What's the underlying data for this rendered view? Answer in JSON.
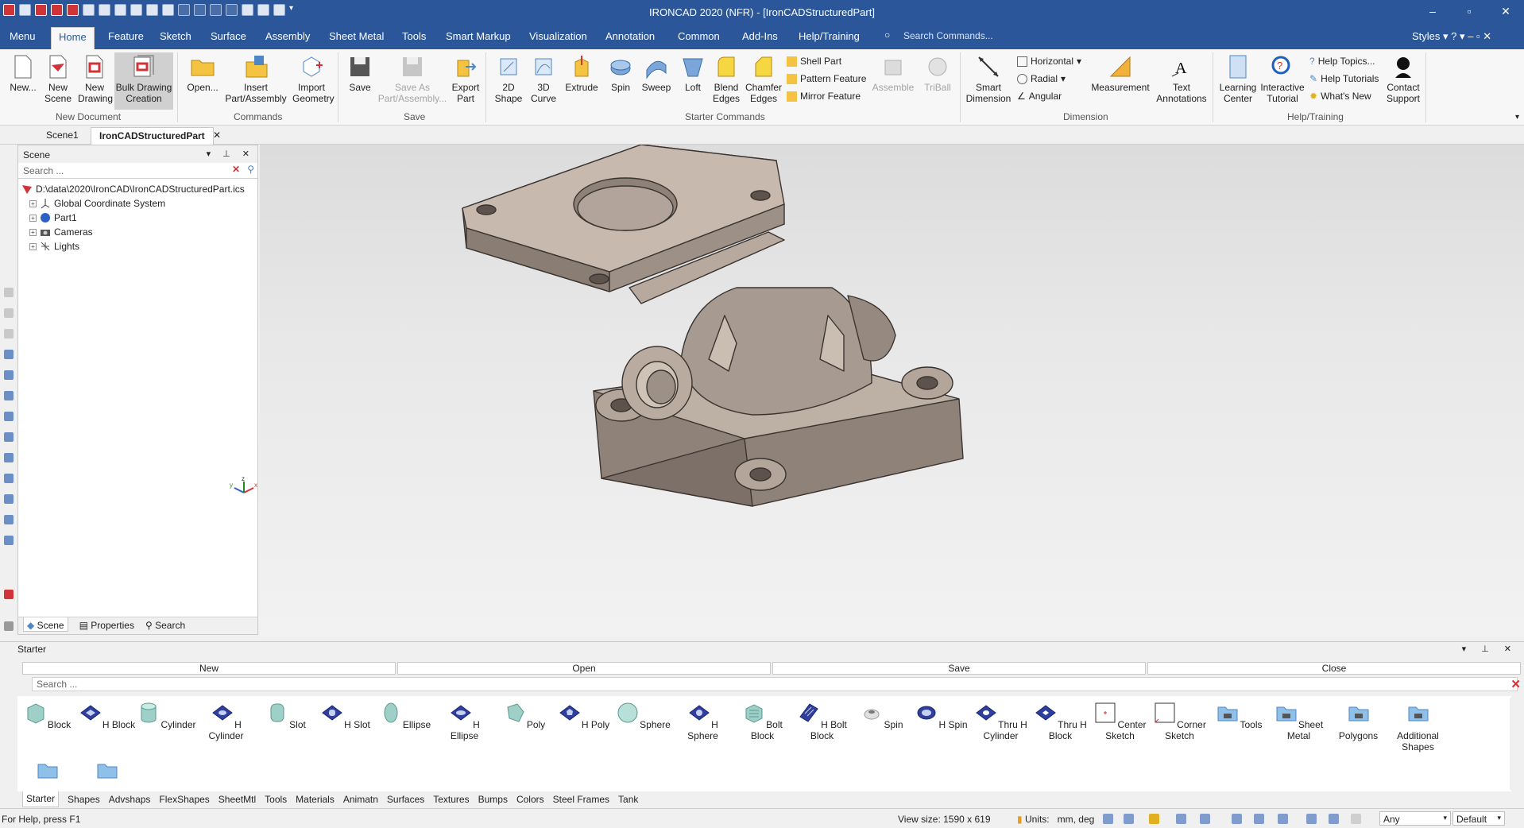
{
  "window": {
    "title": "IRONCAD 2020 (NFR) - [IronCADStructuredPart]"
  },
  "menu_tabs": [
    "Menu",
    "Home",
    "Feature",
    "Sketch",
    "Surface",
    "Assembly",
    "Sheet Metal",
    "Tools",
    "Smart Markup",
    "Visualization",
    "Annotation",
    "Common",
    "Add-Ins",
    "Help/Training"
  ],
  "search_commands": "Search Commands...",
  "styles_label": "Styles",
  "ribbon": {
    "new_document": {
      "label": "New Document",
      "new": "New...",
      "new_scene": "New\nScene",
      "new_drawing": "New\nDrawing",
      "bulk_drawing": "Bulk Drawing\nCreation"
    },
    "commands": {
      "label": "Commands",
      "open": "Open...",
      "insert": "Insert\nPart/Assembly",
      "import": "Import\nGeometry"
    },
    "save": {
      "label": "Save",
      "save": "Save",
      "save_as": "Save As\nPart/Assembly...",
      "export": "Export\nPart"
    },
    "starter_commands": {
      "label": "Starter Commands",
      "shape2d": "2D\nShape",
      "curve3d": "3D\nCurve",
      "extrude": "Extrude",
      "spin": "Spin",
      "sweep": "Sweep",
      "loft": "Loft",
      "blend": "Blend\nEdges",
      "chamfer": "Chamfer\nEdges",
      "shell": "Shell Part",
      "pattern": "Pattern Feature",
      "mirror": "Mirror Feature",
      "assemble": "Assemble",
      "triball": "TriBall"
    },
    "dimension": {
      "label": "Dimension",
      "smart": "Smart\nDimension",
      "horizontal": "Horizontal",
      "radial": "Radial",
      "angular": "Angular",
      "measurement": "Measurement",
      "text": "Text\nAnnotations"
    },
    "help": {
      "label": "Help/Training",
      "learning": "Learning\nCenter",
      "interactive": "Interactive\nTutorial",
      "topics": "Help Topics...",
      "tutorials": "Help Tutorials",
      "whats_new": "What's New",
      "contact": "Contact\nSupport"
    }
  },
  "doc_tabs": [
    "Scene1",
    "IronCADStructuredPart"
  ],
  "scene_panel": {
    "title": "Scene",
    "search_placeholder": "Search ...",
    "tree": [
      "D:\\data\\2020\\IronCAD\\IronCADStructuredPart.ics",
      "Global Coordinate System",
      "Part1",
      "Cameras",
      "Lights"
    ],
    "tabs": [
      "Scene",
      "Properties",
      "Search"
    ]
  },
  "starter": {
    "title": "Starter",
    "bar": [
      "New",
      "Open",
      "Save",
      "Close"
    ],
    "search_placeholder": "Search ...",
    "shapes": [
      "Block",
      "H Block",
      "Cylinder",
      "H Cylinder",
      "Slot",
      "H Slot",
      "Ellipse",
      "H Ellipse",
      "Poly",
      "H Poly",
      "Sphere",
      "H Sphere",
      "Bolt Block",
      "H Bolt Block",
      "Spin",
      "H Spin",
      "Thru H\nCylinder",
      "Thru H Block",
      "Center\nSketch",
      "Corner\nSketch",
      "Tools",
      "Sheet Metal",
      "Polygons",
      "Additional\nShapes"
    ],
    "catalog_tabs": [
      "Starter",
      "Shapes",
      "Advshaps",
      "FlexShapes",
      "SheetMtl",
      "Tools",
      "Materials",
      "Animatn",
      "Surfaces",
      "Textures",
      "Bumps",
      "Colors",
      "Steel Frames",
      "Tank"
    ]
  },
  "status": {
    "help": "For Help, press F1",
    "view_size": "View size: 1590 x  619",
    "units_label": "Units:",
    "units": "mm, deg",
    "selection": "Any",
    "style": "Default"
  },
  "colors": {
    "brand": "#2b579a",
    "part": "#b6a79c"
  }
}
